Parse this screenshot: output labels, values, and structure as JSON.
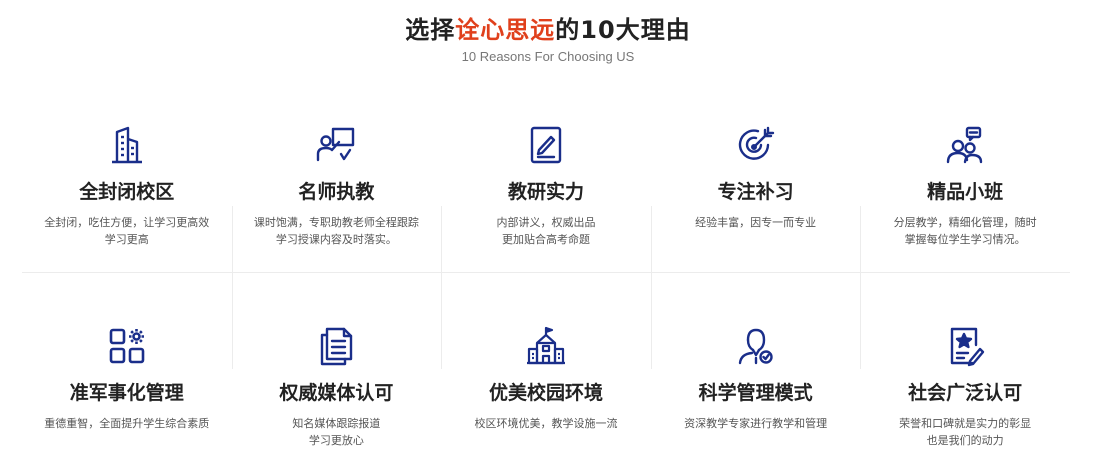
{
  "header": {
    "title_prefix": "选择",
    "title_highlight": "诠心思远",
    "title_suffix": "的10大理由",
    "subtitle": "10 Reasons For Choosing US"
  },
  "colors": {
    "accent": "#e0401c",
    "icon": "#1a2e8a"
  },
  "reasons": [
    {
      "icon": "building-icon",
      "title": "全封闭校区",
      "desc": [
        "全封闭，吃住方便，让学习更高效",
        "学习更高"
      ]
    },
    {
      "icon": "teacher-board-icon",
      "title": "名师执教",
      "desc": [
        "课时饱满，专职助教老师全程跟踪",
        "学习授课内容及时落实。"
      ]
    },
    {
      "icon": "notebook-pen-icon",
      "title": "教研实力",
      "desc": [
        "内部讲义，权威出品",
        "更加贴合高考命题"
      ]
    },
    {
      "icon": "target-icon",
      "title": "专注补习",
      "desc": [
        "经验丰富，因专一而专业"
      ]
    },
    {
      "icon": "group-chat-icon",
      "title": "精品小班",
      "desc": [
        "分层教学，精细化管理，随时",
        "掌握每位学生学习情况。"
      ]
    },
    {
      "icon": "grid-gear-icon",
      "title": "准军事化管理",
      "desc": [
        "重德重智，全面提升学生综合素质"
      ]
    },
    {
      "icon": "document-icon",
      "title": "权威媒体认可",
      "desc": [
        "知名媒体跟踪报道",
        "学习更放心"
      ]
    },
    {
      "icon": "school-icon",
      "title": "优美校园环境",
      "desc": [
        "校区环境优美，教学设施一流"
      ]
    },
    {
      "icon": "user-check-icon",
      "title": "科学管理模式",
      "desc": [
        "资深教学专家进行教学和管理"
      ]
    },
    {
      "icon": "certificate-star-icon",
      "title": "社会广泛认可",
      "desc": [
        "荣誉和口碑就是实力的彰显",
        "也是我们的动力"
      ]
    }
  ]
}
